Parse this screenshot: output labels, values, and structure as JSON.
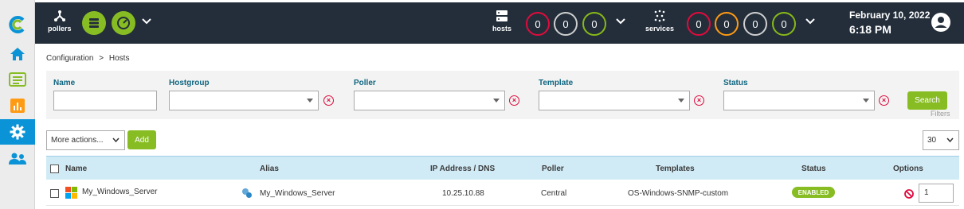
{
  "topbar": {
    "pollers_label": "pollers",
    "hosts_label": "hosts",
    "services_label": "services",
    "host_counts": [
      "0",
      "0",
      "0"
    ],
    "service_counts": [
      "0",
      "0",
      "0",
      "0"
    ],
    "date": "February 10, 2022",
    "time": "6:18 PM"
  },
  "breadcrumb": {
    "parent": "Configuration",
    "separator": ">",
    "current": "Hosts"
  },
  "filters": {
    "name_label": "Name",
    "name_value": "",
    "hostgroup_label": "Hostgroup",
    "hostgroup_value": "",
    "poller_label": "Poller",
    "poller_value": "",
    "template_label": "Template",
    "template_value": "",
    "status_label": "Status",
    "status_value": "",
    "search_button": "Search",
    "filters_link": "Filters"
  },
  "actions": {
    "more_actions": "More actions...",
    "add_button": "Add",
    "page_size": "30"
  },
  "table": {
    "columns": [
      "Name",
      "Alias",
      "IP Address / DNS",
      "Poller",
      "Templates",
      "Status",
      "Options"
    ],
    "rows": [
      {
        "name": "My_Windows_Server",
        "alias": "My_Windows_Server",
        "ip": "10.25.10.88",
        "poller": "Central",
        "template": "OS-Windows-SNMP-custom",
        "status": "ENABLED",
        "duplicate_count": "1"
      }
    ]
  },
  "colors": {
    "accent_green": "#87bd23",
    "topbar_bg": "#232e3a",
    "sidebar_active": "#0a93d6",
    "critical_red": "#e00b3d",
    "warning_orange": "#ff9a13",
    "ok_green": "#88b917",
    "table_header_bg": "#d1ebf6",
    "label_teal": "#0f6580"
  },
  "icons": [
    "centreon-logo-icon",
    "home-icon",
    "list-icon",
    "chart-icon",
    "gear-icon",
    "users-icon",
    "pollers-icon",
    "database-icon",
    "gauge-icon",
    "server-icon",
    "services-icon",
    "user-account-icon",
    "windows-logo-icon",
    "duplicate-icon",
    "disable-icon"
  ]
}
